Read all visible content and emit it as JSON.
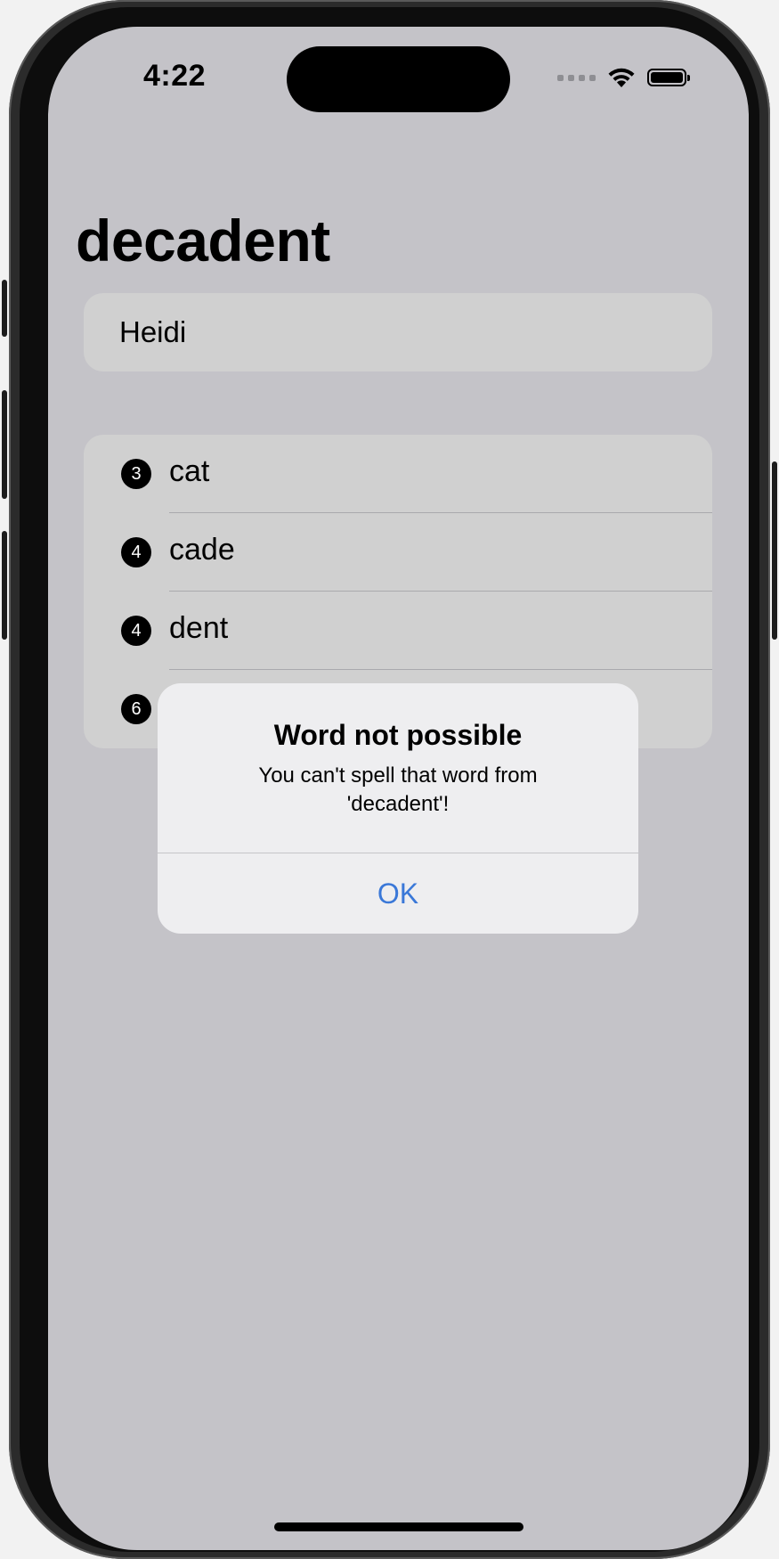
{
  "status_bar": {
    "time": "4:22"
  },
  "nav": {
    "title": "decadent"
  },
  "input": {
    "value": "Heidi"
  },
  "words": [
    {
      "count": "3",
      "word": "cat"
    },
    {
      "count": "4",
      "word": "cade"
    },
    {
      "count": "4",
      "word": "dent"
    },
    {
      "count": "6",
      "word": ""
    }
  ],
  "alert": {
    "title": "Word not possible",
    "message": "You can't spell that word from 'decadent'!",
    "ok_label": "OK"
  },
  "colors": {
    "screen_background": "#c4c3c8",
    "accent": "#3a78d8"
  },
  "icons": {
    "status": [
      "signal-icon",
      "wifi-icon",
      "battery-icon"
    ],
    "badges": [
      "3-circle-fill-icon",
      "4-circle-fill-icon",
      "4-circle-fill-icon",
      "6-circle-fill-icon"
    ]
  }
}
